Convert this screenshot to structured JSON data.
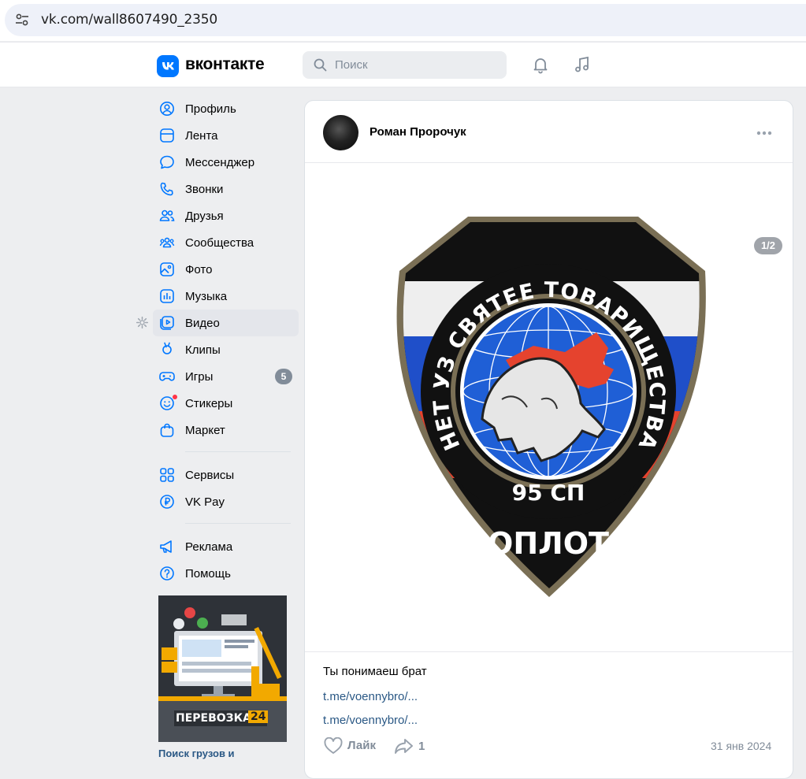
{
  "browser": {
    "url": "vk.com/wall8607490_2350"
  },
  "header": {
    "logo_text": "вконтакте",
    "search_placeholder": "Поиск",
    "accent": "#0077ff"
  },
  "sidebar": {
    "items": [
      {
        "label": "Профиль",
        "icon": "profile-icon"
      },
      {
        "label": "Лента",
        "icon": "feed-icon"
      },
      {
        "label": "Мессенджер",
        "icon": "messenger-icon"
      },
      {
        "label": "Звонки",
        "icon": "phone-icon"
      },
      {
        "label": "Друзья",
        "icon": "friends-icon"
      },
      {
        "label": "Сообщества",
        "icon": "communities-icon"
      },
      {
        "label": "Фото",
        "icon": "photo-icon"
      },
      {
        "label": "Музыка",
        "icon": "music-icon"
      },
      {
        "label": "Видео",
        "icon": "video-icon",
        "active": true
      },
      {
        "label": "Клипы",
        "icon": "clips-icon"
      },
      {
        "label": "Игры",
        "icon": "games-icon",
        "badge": "5"
      },
      {
        "label": "Стикеры",
        "icon": "stickers-icon"
      },
      {
        "label": "Маркет",
        "icon": "market-icon"
      }
    ],
    "items2": [
      {
        "label": "Сервисы",
        "icon": "services-icon"
      },
      {
        "label": "VK Pay",
        "icon": "vkpay-icon"
      }
    ],
    "items3": [
      {
        "label": "Реклама",
        "icon": "ads-icon"
      },
      {
        "label": "Помощь",
        "icon": "help-icon"
      }
    ],
    "ad": {
      "banner_text": "ПЕРЕВОЗКА",
      "banner_number": "24",
      "caption": "Поиск грузов и"
    }
  },
  "post": {
    "author": "Роман Пророчук",
    "photo_counter": "1/2",
    "emblem": {
      "arc_text": "НЕТ УЗ СВЯТЕЕ ТОВАРИЩЕСТВА",
      "unit": "95 СП",
      "name": "ОПЛОТ"
    },
    "text": "Ты понимаеш брат",
    "links": [
      "t.me/voennybro/...",
      "t.me/voennybro/..."
    ],
    "like_label": "Лайк",
    "share_count": "1",
    "date": "31 янв 2024"
  }
}
